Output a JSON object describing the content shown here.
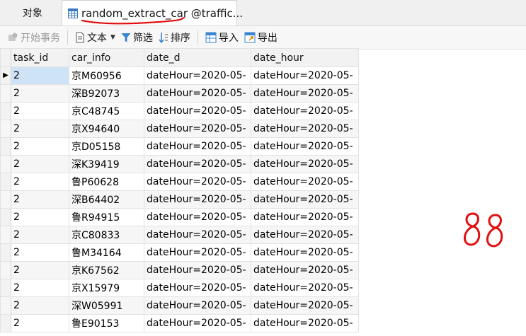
{
  "tabs": {
    "objects_label": "对象",
    "table_tab_label": "random_extract_car @traffic..."
  },
  "toolbar": {
    "begin_transaction": "开始事务",
    "text": "文本",
    "filter": "筛选",
    "sort": "排序",
    "import": "导入",
    "export": "导出"
  },
  "grid": {
    "columns": [
      "task_id",
      "car_info",
      "date_d",
      "date_hour"
    ],
    "rows": [
      [
        "2",
        "京M60956",
        "dateHour=2020-05-",
        "dateHour=2020-05-"
      ],
      [
        "2",
        "深B92073",
        "dateHour=2020-05-",
        "dateHour=2020-05-"
      ],
      [
        "2",
        "京C48745",
        "dateHour=2020-05-",
        "dateHour=2020-05-"
      ],
      [
        "2",
        "京X94640",
        "dateHour=2020-05-",
        "dateHour=2020-05-"
      ],
      [
        "2",
        "京D05158",
        "dateHour=2020-05-",
        "dateHour=2020-05-"
      ],
      [
        "2",
        "深K39419",
        "dateHour=2020-05-",
        "dateHour=2020-05-"
      ],
      [
        "2",
        "鲁P60628",
        "dateHour=2020-05-",
        "dateHour=2020-05-"
      ],
      [
        "2",
        "深B64402",
        "dateHour=2020-05-",
        "dateHour=2020-05-"
      ],
      [
        "2",
        "鲁R94915",
        "dateHour=2020-05-",
        "dateHour=2020-05-"
      ],
      [
        "2",
        "京C80833",
        "dateHour=2020-05-",
        "dateHour=2020-05-"
      ],
      [
        "2",
        "鲁M34164",
        "dateHour=2020-05-",
        "dateHour=2020-05-"
      ],
      [
        "2",
        "京K67562",
        "dateHour=2020-05-",
        "dateHour=2020-05-"
      ],
      [
        "2",
        "京X15979",
        "dateHour=2020-05-",
        "dateHour=2020-05-"
      ],
      [
        "2",
        "深W05991",
        "dateHour=2020-05-",
        "dateHour=2020-05-"
      ],
      [
        "2",
        "鲁E90153",
        "dateHour=2020-05-",
        "dateHour=2020-05-"
      ]
    ]
  },
  "annotation": {
    "handwritten_text": "88",
    "ink_color": "#e01010"
  },
  "icons": {
    "table_tab": "table-grid-icon",
    "begin_transaction": "transaction-icon",
    "text": "document-icon",
    "filter": "funnel-icon",
    "sort": "sort-icon",
    "import": "import-icon",
    "export": "export-icon"
  }
}
